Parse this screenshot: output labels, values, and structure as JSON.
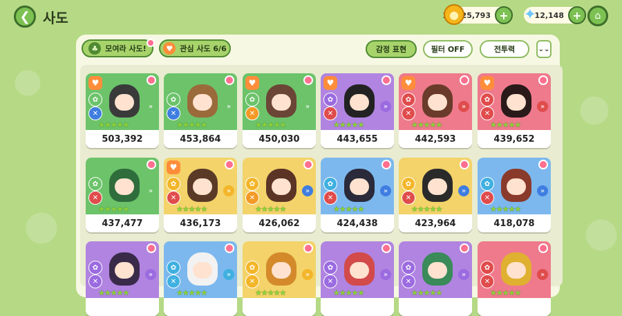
{
  "title": "사도",
  "currency": {
    "gold": "11,025,793",
    "gems": "12,148",
    "gold_icon": "coin-icon",
    "gem_icon": "crystal-icon"
  },
  "filters": {
    "collect": "모여라 사도!",
    "favorite": "관심 사도  6/6",
    "emotion": "감정 표현",
    "filter": "필터 OFF",
    "power": "전투력"
  },
  "cards": [
    {
      "power": "503,392",
      "bg": "#6cc36a",
      "hair": "#3a3a3a",
      "heart": true,
      "b1": "#6cc36a",
      "b2": "#3f7de0",
      "arrow": "#6cc36a"
    },
    {
      "power": "453,864",
      "bg": "#6cc36a",
      "hair": "#9b6a3a",
      "heart": false,
      "b1": "#6cc36a",
      "b2": "#3f7de0",
      "arrow": "#6cc36a"
    },
    {
      "power": "450,030",
      "bg": "#6cc36a",
      "hair": "#6b4636",
      "heart": true,
      "b1": "#6cc36a",
      "b2": "#f39a26",
      "arrow": "#6cc36a"
    },
    {
      "power": "443,655",
      "bg": "#b084e0",
      "hair": "#222222",
      "heart": true,
      "b1": "#9b6be0",
      "b2": "#e04c4c",
      "arrow": "#9b6be0"
    },
    {
      "power": "442,593",
      "bg": "#ee7a8c",
      "hair": "#6a3b2a",
      "heart": true,
      "b1": "#e04c4c",
      "b2": "#e04c4c",
      "arrow": "#e04c4c"
    },
    {
      "power": "439,652",
      "bg": "#ee7a8c",
      "hair": "#2a1a1a",
      "heart": true,
      "b1": "#e04c4c",
      "b2": "#e04c4c",
      "arrow": "#e04c4c"
    },
    {
      "power": "437,477",
      "bg": "#6cc36a",
      "hair": "#2f6d3c",
      "heart": false,
      "b1": "#6cc36a",
      "b2": "#e04c4c",
      "arrow": "#6cc36a"
    },
    {
      "power": "436,173",
      "bg": "#f3d36a",
      "hair": "#5a3a26",
      "heart": true,
      "b1": "#f3b62a",
      "b2": "#e04c4c",
      "arrow": "#f3b62a"
    },
    {
      "power": "426,062",
      "bg": "#f3d36a",
      "hair": "#5b3426",
      "heart": false,
      "b1": "#f3b62a",
      "b2": "#f39a26",
      "arrow": "#3f7de0"
    },
    {
      "power": "424,438",
      "bg": "#7cb8ee",
      "hair": "#2a2a3a",
      "heart": false,
      "b1": "#3fb0e0",
      "b2": "#e04c4c",
      "arrow": "#3f7de0"
    },
    {
      "power": "423,964",
      "bg": "#f3d36a",
      "hair": "#2a2a2a",
      "heart": false,
      "b1": "#f3b62a",
      "b2": "#e04c4c",
      "arrow": "#3f7de0"
    },
    {
      "power": "418,078",
      "bg": "#7cb8ee",
      "hair": "#8a3a2a",
      "heart": false,
      "b1": "#3fb0e0",
      "b2": "#e04c4c",
      "arrow": "#3f7de0"
    },
    {
      "power": "",
      "bg": "#b084e0",
      "hair": "#3a2a4a",
      "heart": false,
      "b1": "#9b6be0",
      "b2": "#9b6be0",
      "arrow": "#9b6be0"
    },
    {
      "power": "",
      "bg": "#7cb8ee",
      "hair": "#f2f2f2",
      "heart": false,
      "b1": "#3fb0e0",
      "b2": "#3fb0e0",
      "arrow": "#3fb0e0"
    },
    {
      "power": "",
      "bg": "#f3d36a",
      "hair": "#d48a2a",
      "heart": false,
      "b1": "#f3b62a",
      "b2": "#f3b62a",
      "arrow": "#f3b62a"
    },
    {
      "power": "",
      "bg": "#b084e0",
      "hair": "#d24a4a",
      "heart": false,
      "b1": "#9b6be0",
      "b2": "#9b6be0",
      "arrow": "#9b6be0"
    },
    {
      "power": "",
      "bg": "#b084e0",
      "hair": "#3a8a5a",
      "heart": false,
      "b1": "#9b6be0",
      "b2": "#9b6be0",
      "arrow": "#9b6be0"
    },
    {
      "power": "",
      "bg": "#ee7a8c",
      "hair": "#e0b030",
      "heart": false,
      "b1": "#e04c4c",
      "b2": "#e04c4c",
      "arrow": "#e04c4c"
    }
  ]
}
